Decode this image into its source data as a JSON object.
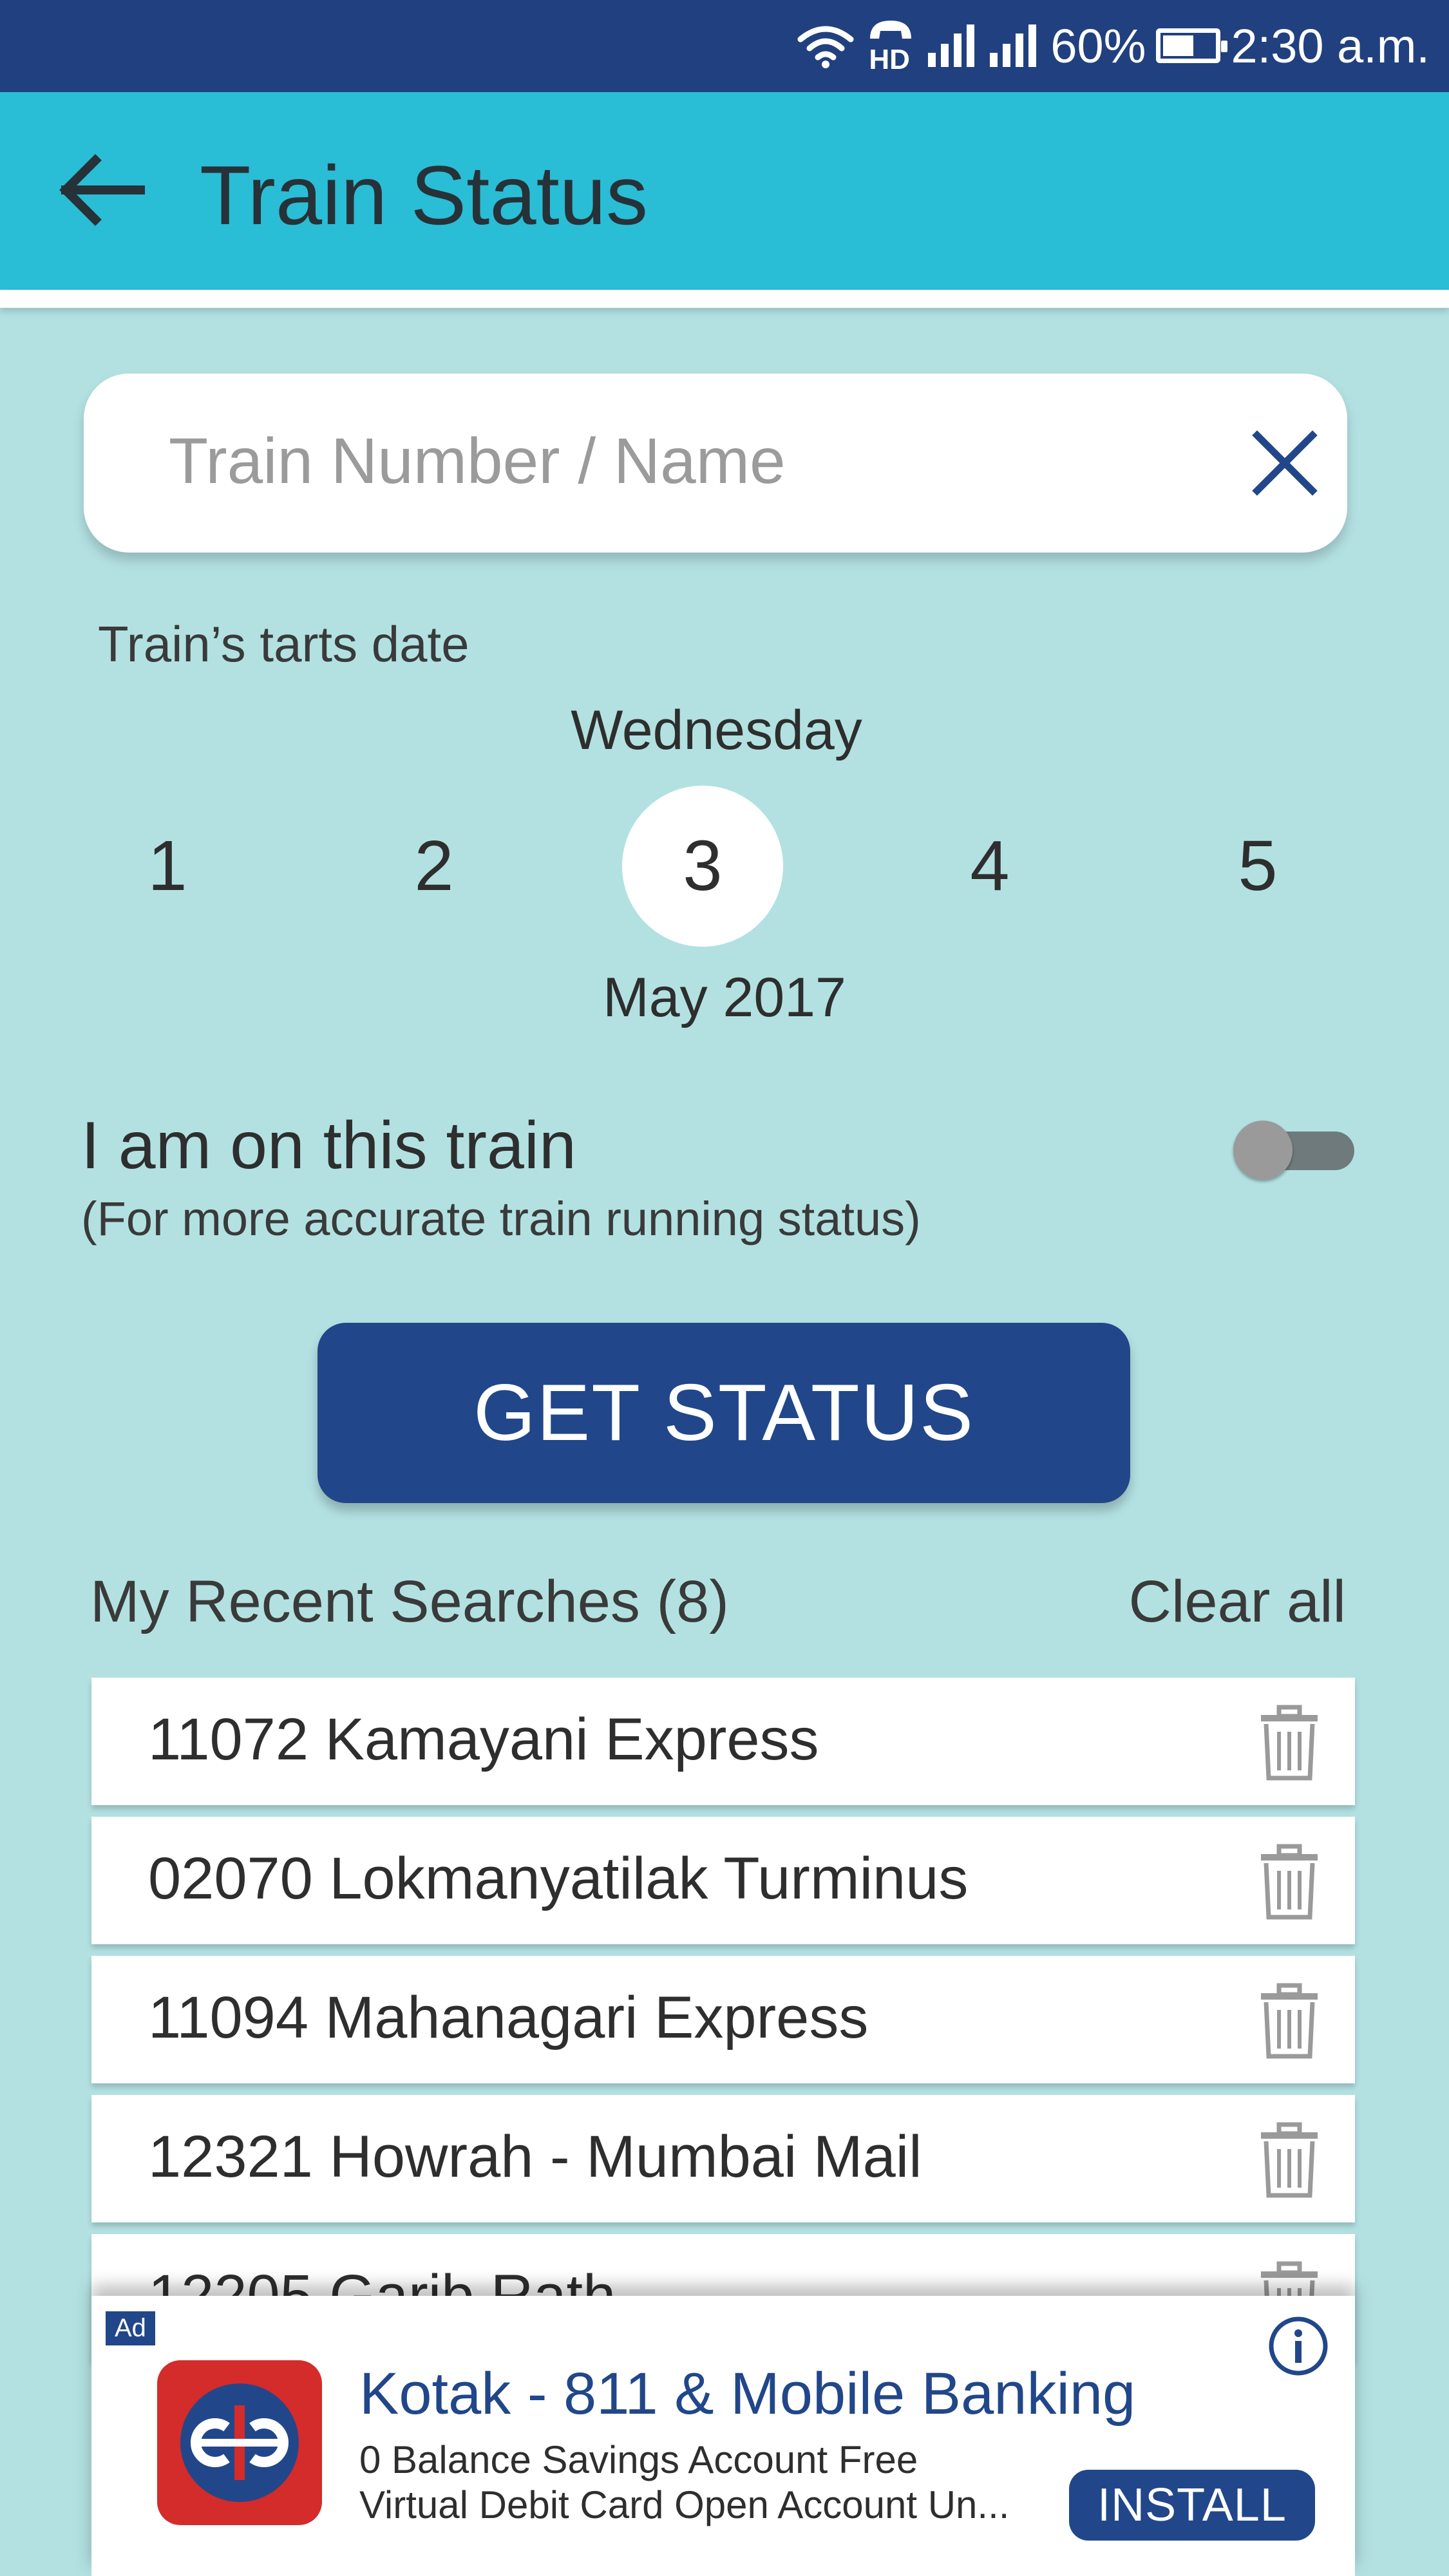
{
  "status_bar": {
    "icons": [
      "wifi-icon",
      "hd-call-icon",
      "signal-icon",
      "signal-icon",
      "battery-icon"
    ],
    "hd_label": "HD",
    "battery_percent": "60%",
    "battery_level": 0.6,
    "time": "2:30 a.m."
  },
  "app_bar": {
    "title": "Train Status",
    "back_icon": "arrow-left-icon",
    "color": "#2abdd6"
  },
  "search": {
    "placeholder": "Train Number / Name",
    "value": "",
    "clear_icon": "close-icon"
  },
  "date_picker": {
    "caption": "Train’s tarts date",
    "weekday": "Wednesday",
    "days": [
      "1",
      "2",
      "3",
      "4",
      "5"
    ],
    "selected_day": "3",
    "month_year": "May 2017"
  },
  "onboard": {
    "title": "I am on this train",
    "subtitle": "(For more accurate train running status)",
    "toggle_on": false
  },
  "get_status_label": "GET STATUS",
  "recent": {
    "title": "My Recent Searches (8)",
    "clear_all": "Clear all",
    "items": [
      "11072 Kamayani Express",
      "02070 Lokmanyatilak Turminus",
      "11094 Mahanagari Express",
      "12321 Howrah - Mumbai Mail",
      "12205 Garib Rath"
    ],
    "item_icon": "trash-icon"
  },
  "ad": {
    "badge": "Ad",
    "title": "Kotak - 811 & Mobile Banking",
    "line1": "0 Balance Savings Account Free",
    "line2": "Virtual Debit Card  Open Account Un...",
    "install": "INSTALL",
    "info_icon": "info-icon",
    "logo_icon": "kotak-logo-icon"
  },
  "colors": {
    "status_bar": "#21407f",
    "background": "#b3e1e2",
    "primary_button": "#21478a"
  }
}
